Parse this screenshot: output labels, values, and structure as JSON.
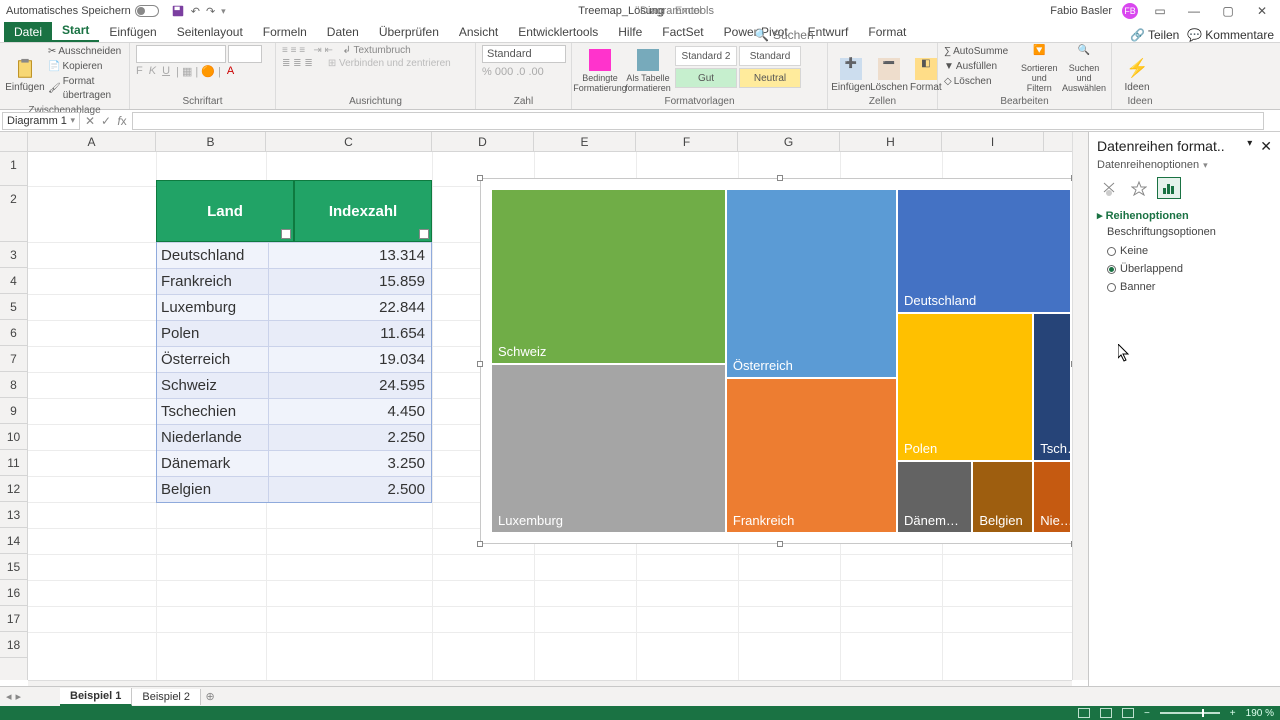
{
  "titlebar": {
    "autosave": "Automatisches Speichern",
    "docname": "Treemap_Lösung",
    "appname": "- Excel",
    "tools": "Diagrammtools",
    "user": "Fabio Basler",
    "avatar": "FB"
  },
  "tabs": {
    "file": "Datei",
    "items": [
      "Start",
      "Einfügen",
      "Seitenlayout",
      "Formeln",
      "Daten",
      "Überprüfen",
      "Ansicht",
      "Entwicklertools",
      "Hilfe",
      "FactSet",
      "Power Pivot",
      "Entwurf",
      "Format"
    ],
    "active": "Start",
    "search": "Suchen",
    "share": "Teilen",
    "comments": "Kommentare"
  },
  "ribbon": {
    "paste": "Einfügen",
    "cut": "Ausschneiden",
    "copy": "Kopieren",
    "formatpainter": "Format übertragen",
    "grp_clipboard": "Zwischenablage",
    "font_name": "",
    "font_size": "",
    "grp_font": "Schriftart",
    "wrap": "Textumbruch",
    "merge": "Verbinden und zentrieren",
    "grp_align": "Ausrichtung",
    "numfmt": "Standard",
    "grp_number": "Zahl",
    "condfmt": "Bedingte Formatierung",
    "astable": "Als Tabelle formatieren",
    "style1": "Standard 2",
    "style2": "Standard",
    "style3": "Gut",
    "style4": "Neutral",
    "grp_styles": "Formatvorlagen",
    "insert": "Einfügen",
    "delete": "Löschen",
    "format": "Format",
    "grp_cells": "Zellen",
    "autosum": "AutoSumme",
    "fill": "Ausfüllen",
    "clear": "Löschen",
    "sort": "Sortieren und Filtern",
    "find": "Suchen und Auswählen",
    "grp_edit": "Bearbeiten",
    "ideas": "Ideen",
    "grp_ideas": "Ideen"
  },
  "namebox": "Diagramm 1",
  "columns": [
    "A",
    "B",
    "C",
    "D",
    "E",
    "F",
    "G",
    "H",
    "I"
  ],
  "rows": [
    1,
    2,
    3,
    4,
    5,
    6,
    7,
    8,
    9,
    10,
    11,
    12,
    13,
    14,
    15,
    16,
    17,
    18
  ],
  "table": {
    "hdr_land": "Land",
    "hdr_index": "Indexzahl",
    "rows": [
      {
        "land": "Deutschland",
        "idx": "13.314"
      },
      {
        "land": "Frankreich",
        "idx": "15.859"
      },
      {
        "land": "Luxemburg",
        "idx": "22.844"
      },
      {
        "land": "Polen",
        "idx": "11.654"
      },
      {
        "land": "Österreich",
        "idx": "19.034"
      },
      {
        "land": "Schweiz",
        "idx": "24.595"
      },
      {
        "land": "Tschechien",
        "idx": "4.450"
      },
      {
        "land": "Niederlande",
        "idx": "2.250"
      },
      {
        "land": "Dänemark",
        "idx": "3.250"
      },
      {
        "land": "Belgien",
        "idx": "2.500"
      }
    ]
  },
  "chart_data": {
    "type": "treemap",
    "values": [
      {
        "name": "Schweiz",
        "value": 24595,
        "color": "#70ad47"
      },
      {
        "name": "Luxemburg",
        "value": 22844,
        "color": "#a5a5a5"
      },
      {
        "name": "Österreich",
        "value": 19034,
        "color": "#5b9bd5"
      },
      {
        "name": "Frankreich",
        "value": 15859,
        "color": "#ed7d31"
      },
      {
        "name": "Deutschland",
        "value": 13314,
        "color": "#4472c4"
      },
      {
        "name": "Polen",
        "value": 11654,
        "color": "#ffc000"
      },
      {
        "name": "Tschechien",
        "value": 4450,
        "color": "#264478"
      },
      {
        "name": "Dänemark",
        "value": 3250,
        "color": "#636363"
      },
      {
        "name": "Belgien",
        "value": 2500,
        "color": "#9e5e0f"
      },
      {
        "name": "Niederlande",
        "value": 2250,
        "color": "#c55a11"
      }
    ]
  },
  "treemap_labels": {
    "schweiz": "Schweiz",
    "luxemburg": "Luxemburg",
    "osterreich": "Österreich",
    "frankreich": "Frankreich",
    "deutschland": "Deutschland",
    "polen": "Polen",
    "tschechien": "Tsch…",
    "danemark": "Dänem…",
    "belgien": "Belgien",
    "niederlande": "Nie…"
  },
  "fmtpane": {
    "title": "Datenreihen format..",
    "subtitle": "Datenreihenoptionen",
    "section": "Reihenoptionen",
    "subheader": "Beschriftungsoptionen",
    "opt_none": "Keine",
    "opt_overlap": "Überlappend",
    "opt_banner": "Banner"
  },
  "sheets": {
    "s1": "Beispiel 1",
    "s2": "Beispiel 2"
  },
  "zoom": "190 %"
}
